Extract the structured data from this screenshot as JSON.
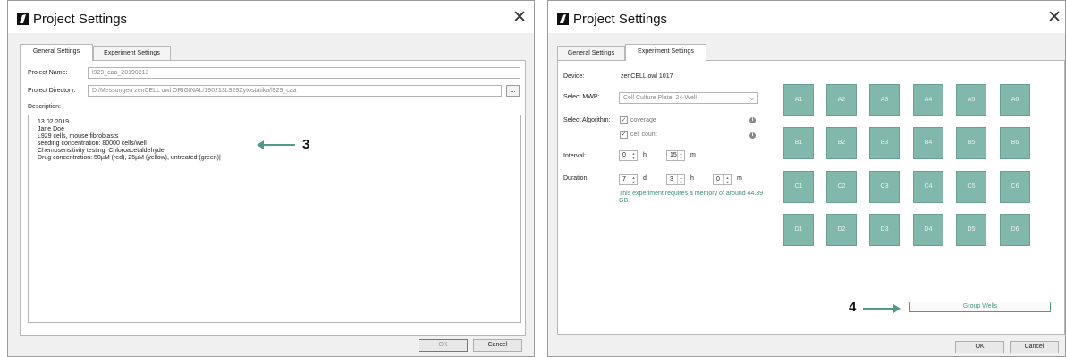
{
  "colors": {
    "accent": "#4f9a8a",
    "well_fill": "#82b7ac"
  },
  "left_dialog": {
    "title": "Project Settings",
    "close_icon": "close-icon",
    "tabs": [
      {
        "label": "General Settings",
        "active": true
      },
      {
        "label": "Experiment Settings",
        "active": false
      }
    ],
    "project_name_label": "Project Name:",
    "project_name_value": "l929_caa_20190213",
    "project_directory_label": "Project Directory:",
    "project_directory_value": "D:/Messungen zenCELL owl ORIGINAL/190213L929Zytostatika/l929_caa",
    "browse_label": "...",
    "description_label": "Description:",
    "description_lines": [
      "13.02.2019",
      "Jane Doe",
      "L929 cells, mouse fibroblasts",
      "seeding concentration: 80000 cells/well",
      "Chemosensitivity testing, Chloroacetaldehyde",
      "Drug concentration: 50µM (red), 25µM (yellow), untreated (green)|"
    ],
    "annotation_number": "3",
    "ok_label": "OK",
    "cancel_label": "Cancel"
  },
  "right_dialog": {
    "title": "Project Settings",
    "close_icon": "close-icon",
    "tabs": [
      {
        "label": "General Settings",
        "active": false
      },
      {
        "label": "Experiment Settings",
        "active": true
      }
    ],
    "device_label": "Device:",
    "device_value": "zenCELL owl 1017",
    "mwp_label": "Select MWP:",
    "mwp_value": "Cell Culture Plate, 24-Well",
    "algorithm_label": "Select Algorithm:",
    "algorithms": [
      {
        "label": "coverage",
        "checked": true
      },
      {
        "label": "cell count",
        "checked": true
      }
    ],
    "interval_label": "Interval:",
    "interval_hours": "0",
    "interval_hours_unit": "h",
    "interval_minutes": "15",
    "interval_minutes_unit": "m",
    "duration_label": "Duration:",
    "duration_days": "7",
    "duration_days_unit": "d",
    "duration_hours": "3",
    "duration_hours_unit": "h",
    "duration_minutes": "0",
    "duration_minutes_unit": "m",
    "memory_note": "This experiment requires a memory of around 44.39 GB.",
    "wells": [
      [
        "A1",
        "A2",
        "A3",
        "A4",
        "A5",
        "A6"
      ],
      [
        "B1",
        "B2",
        "B3",
        "B4",
        "B5",
        "B6"
      ],
      [
        "C1",
        "C2",
        "C3",
        "C4",
        "C5",
        "C6"
      ],
      [
        "D1",
        "D2",
        "D3",
        "D4",
        "D5",
        "D6"
      ]
    ],
    "group_wells_label": "Group Wells",
    "annotation_number": "4",
    "ok_label": "OK",
    "cancel_label": "Cancel"
  }
}
